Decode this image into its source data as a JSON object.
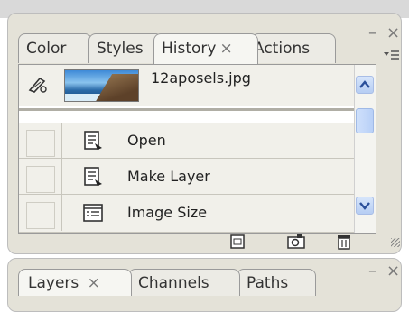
{
  "history_panel": {
    "tabs": [
      {
        "label": "Color"
      },
      {
        "label": "Styles"
      },
      {
        "label": "History",
        "close": "×"
      },
      {
        "label": "Actions"
      }
    ],
    "window_controls": {
      "minimize": "–",
      "close": "×"
    },
    "snapshot": {
      "name": "12aposels.jpg"
    },
    "states": [
      {
        "label": "Open",
        "icon": "document-icon"
      },
      {
        "label": "Make Layer",
        "icon": "document-icon"
      },
      {
        "label": "Image Size",
        "icon": "image-size-icon"
      }
    ],
    "footer_buttons": [
      {
        "name": "new-document-from-state-icon"
      },
      {
        "name": "new-snapshot-icon"
      },
      {
        "name": "trash-icon"
      }
    ]
  },
  "layers_panel": {
    "tabs": [
      {
        "label": "Layers",
        "close": "×"
      },
      {
        "label": "Channels"
      },
      {
        "label": "Paths"
      }
    ],
    "window_controls": {
      "minimize": "–",
      "close": "×"
    }
  },
  "colors": {
    "accent_scroll": "#b6cdf3",
    "panel_bg": "#e4e2d8"
  }
}
